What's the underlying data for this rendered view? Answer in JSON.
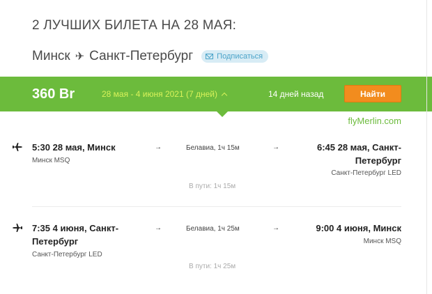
{
  "header": {
    "title": "2 ЛУЧШИХ БИЛЕТА НА 28 МАЯ:",
    "route_from": "Минск",
    "route_to": "Санкт-Петербург",
    "subscribe_label": "Подписаться"
  },
  "bar": {
    "price": "360 Br",
    "dates": "28 мая - 4 июня 2021 (7 дней)",
    "ago": "14 дней назад",
    "find_label": "Найти"
  },
  "brand": "flyMerlin.com",
  "colors": {
    "green": "#6cbb3c",
    "orange": "#f28c1e",
    "date_yellow": "#d8f25a",
    "link_blue": "#4aa3c9"
  },
  "legs": [
    {
      "icon": "plane-departure-icon",
      "dep_time": "5:30 28 мая, Минск",
      "dep_airport": "Минск MSQ",
      "carrier": "Белавиа, 1ч 15м",
      "arr_time": "6:45 28 мая, Санкт-Петербург",
      "arr_airport": "Санкт-Петербург LED",
      "enroute": "В пути: 1ч 15м"
    },
    {
      "icon": "plane-return-icon",
      "dep_time": "7:35 4 июня, Санкт-Петербург",
      "dep_airport": "Санкт-Петербург LED",
      "carrier": "Белавиа, 1ч 25м",
      "arr_time": "9:00 4 июня, Минск",
      "arr_airport": "Минск MSQ",
      "enroute": "В пути: 1ч 25м"
    }
  ]
}
